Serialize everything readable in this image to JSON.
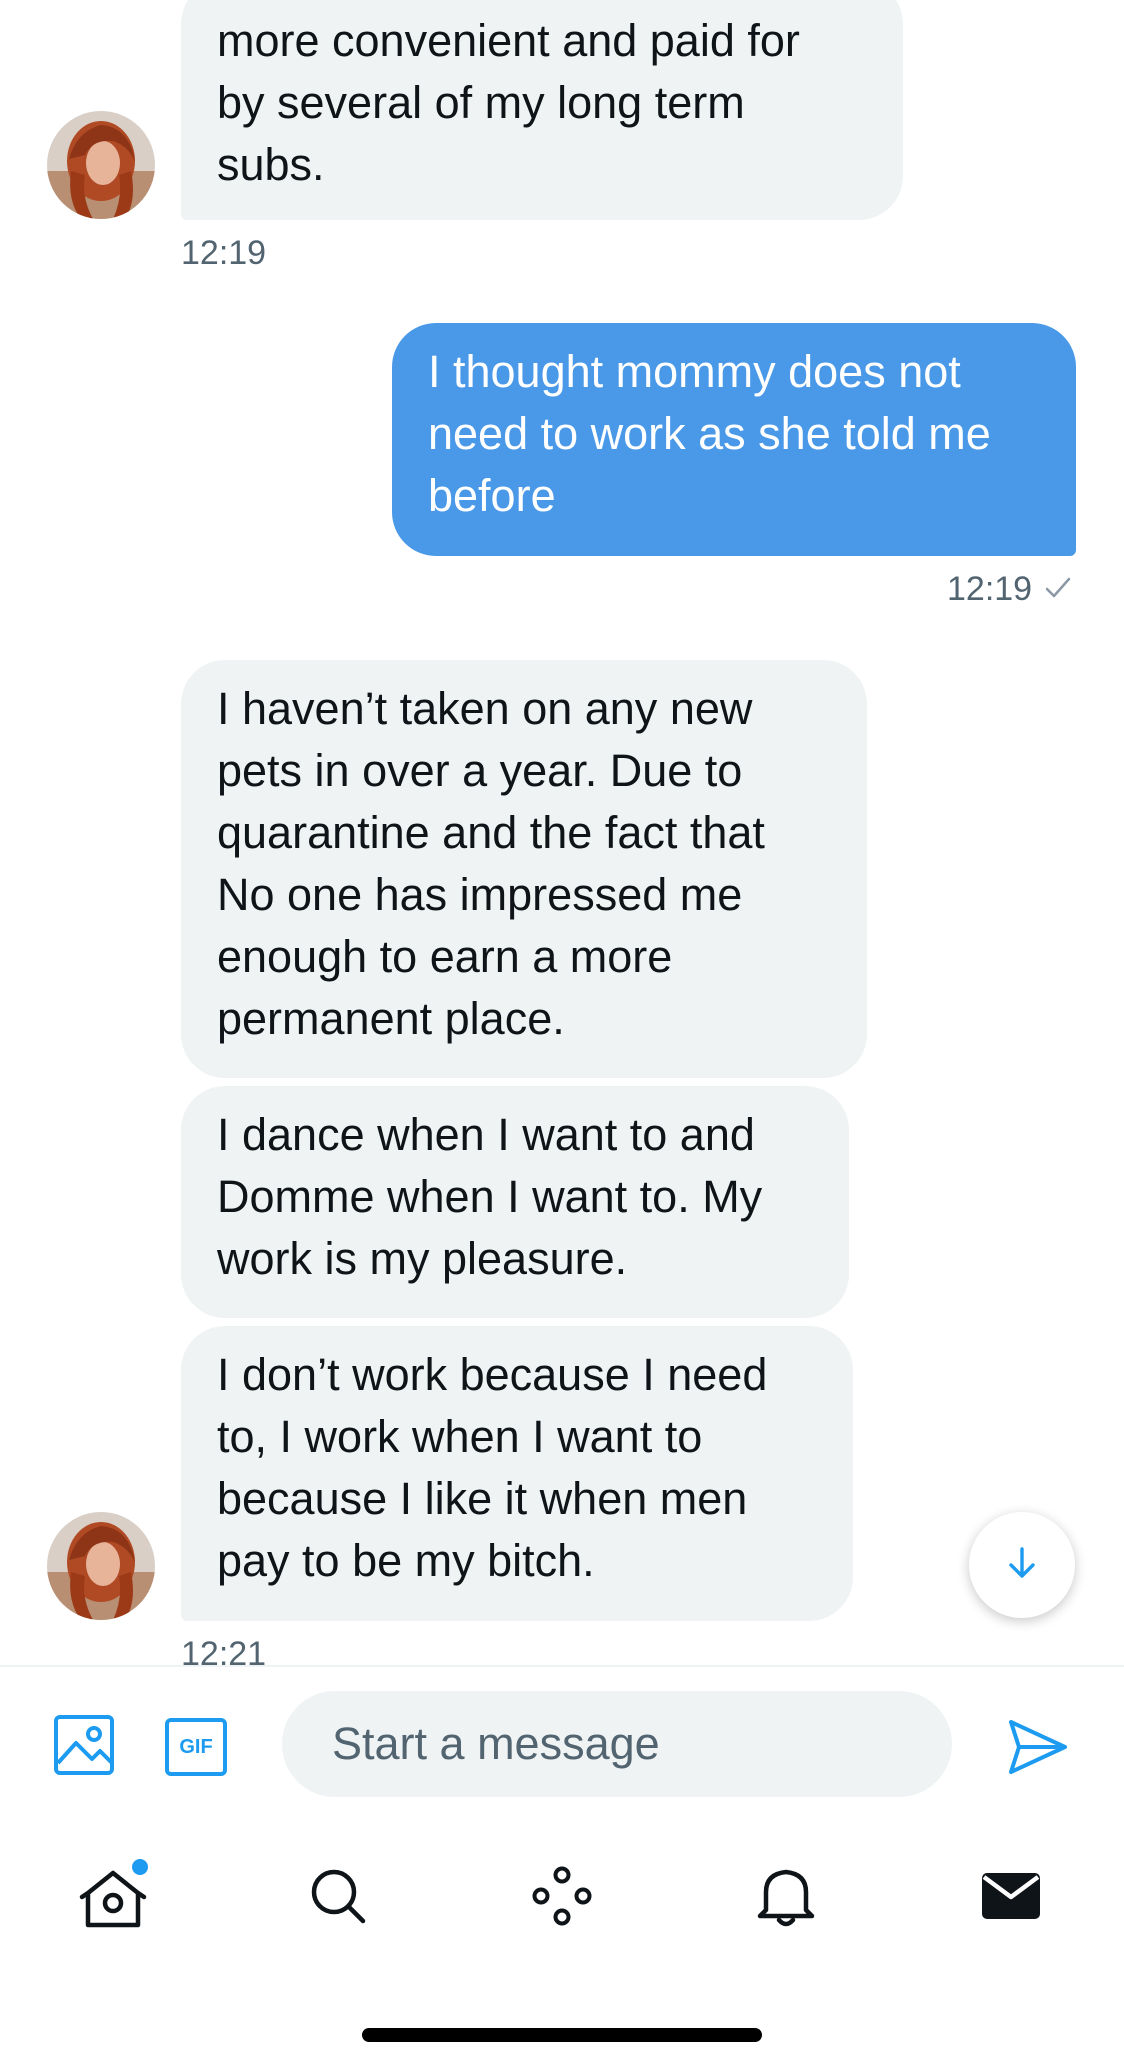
{
  "thread": {
    "messages": [
      {
        "id": "m1",
        "direction": "incoming",
        "text": "more convenient and paid for\nby several of my long term\nsubs."
      },
      {
        "id": "m2",
        "direction": "outgoing",
        "text": "I thought mommy does not\nneed to work as she told me\nbefore"
      },
      {
        "id": "m3",
        "direction": "incoming",
        "text": "I haven’t taken on any new\npets in over a year. Due to\nquarantine and the fact that\nNo one has impressed me\nenough to earn a more\npermanent place."
      },
      {
        "id": "m4",
        "direction": "incoming",
        "text": "I dance when I want to and\nDomme when I want to. My\nwork is my pleasure."
      },
      {
        "id": "m5",
        "direction": "incoming",
        "text": "I don’t work because I need\nto, I work when I want to\nbecause I like it when men\npay to be my bitch."
      }
    ],
    "timestamps": {
      "group1": "12:19",
      "group2": "12:19",
      "group3": "12:21"
    },
    "read_receipt_icon": "checkmark-icon"
  },
  "composer": {
    "placeholder": "Start a message",
    "gif_label": "GIF",
    "icons": [
      "image-icon",
      "gif-icon",
      "send-icon"
    ]
  },
  "tabbar": {
    "items": [
      "home-icon",
      "search-icon",
      "spaces-icon",
      "notifications-icon",
      "messages-icon"
    ],
    "home_has_new_dot": true
  },
  "colors": {
    "accent": "#1d9bf0",
    "outgoing_bubble": "#4a99e9",
    "incoming_bubble": "#eff3f4",
    "muted_text": "#536471"
  }
}
